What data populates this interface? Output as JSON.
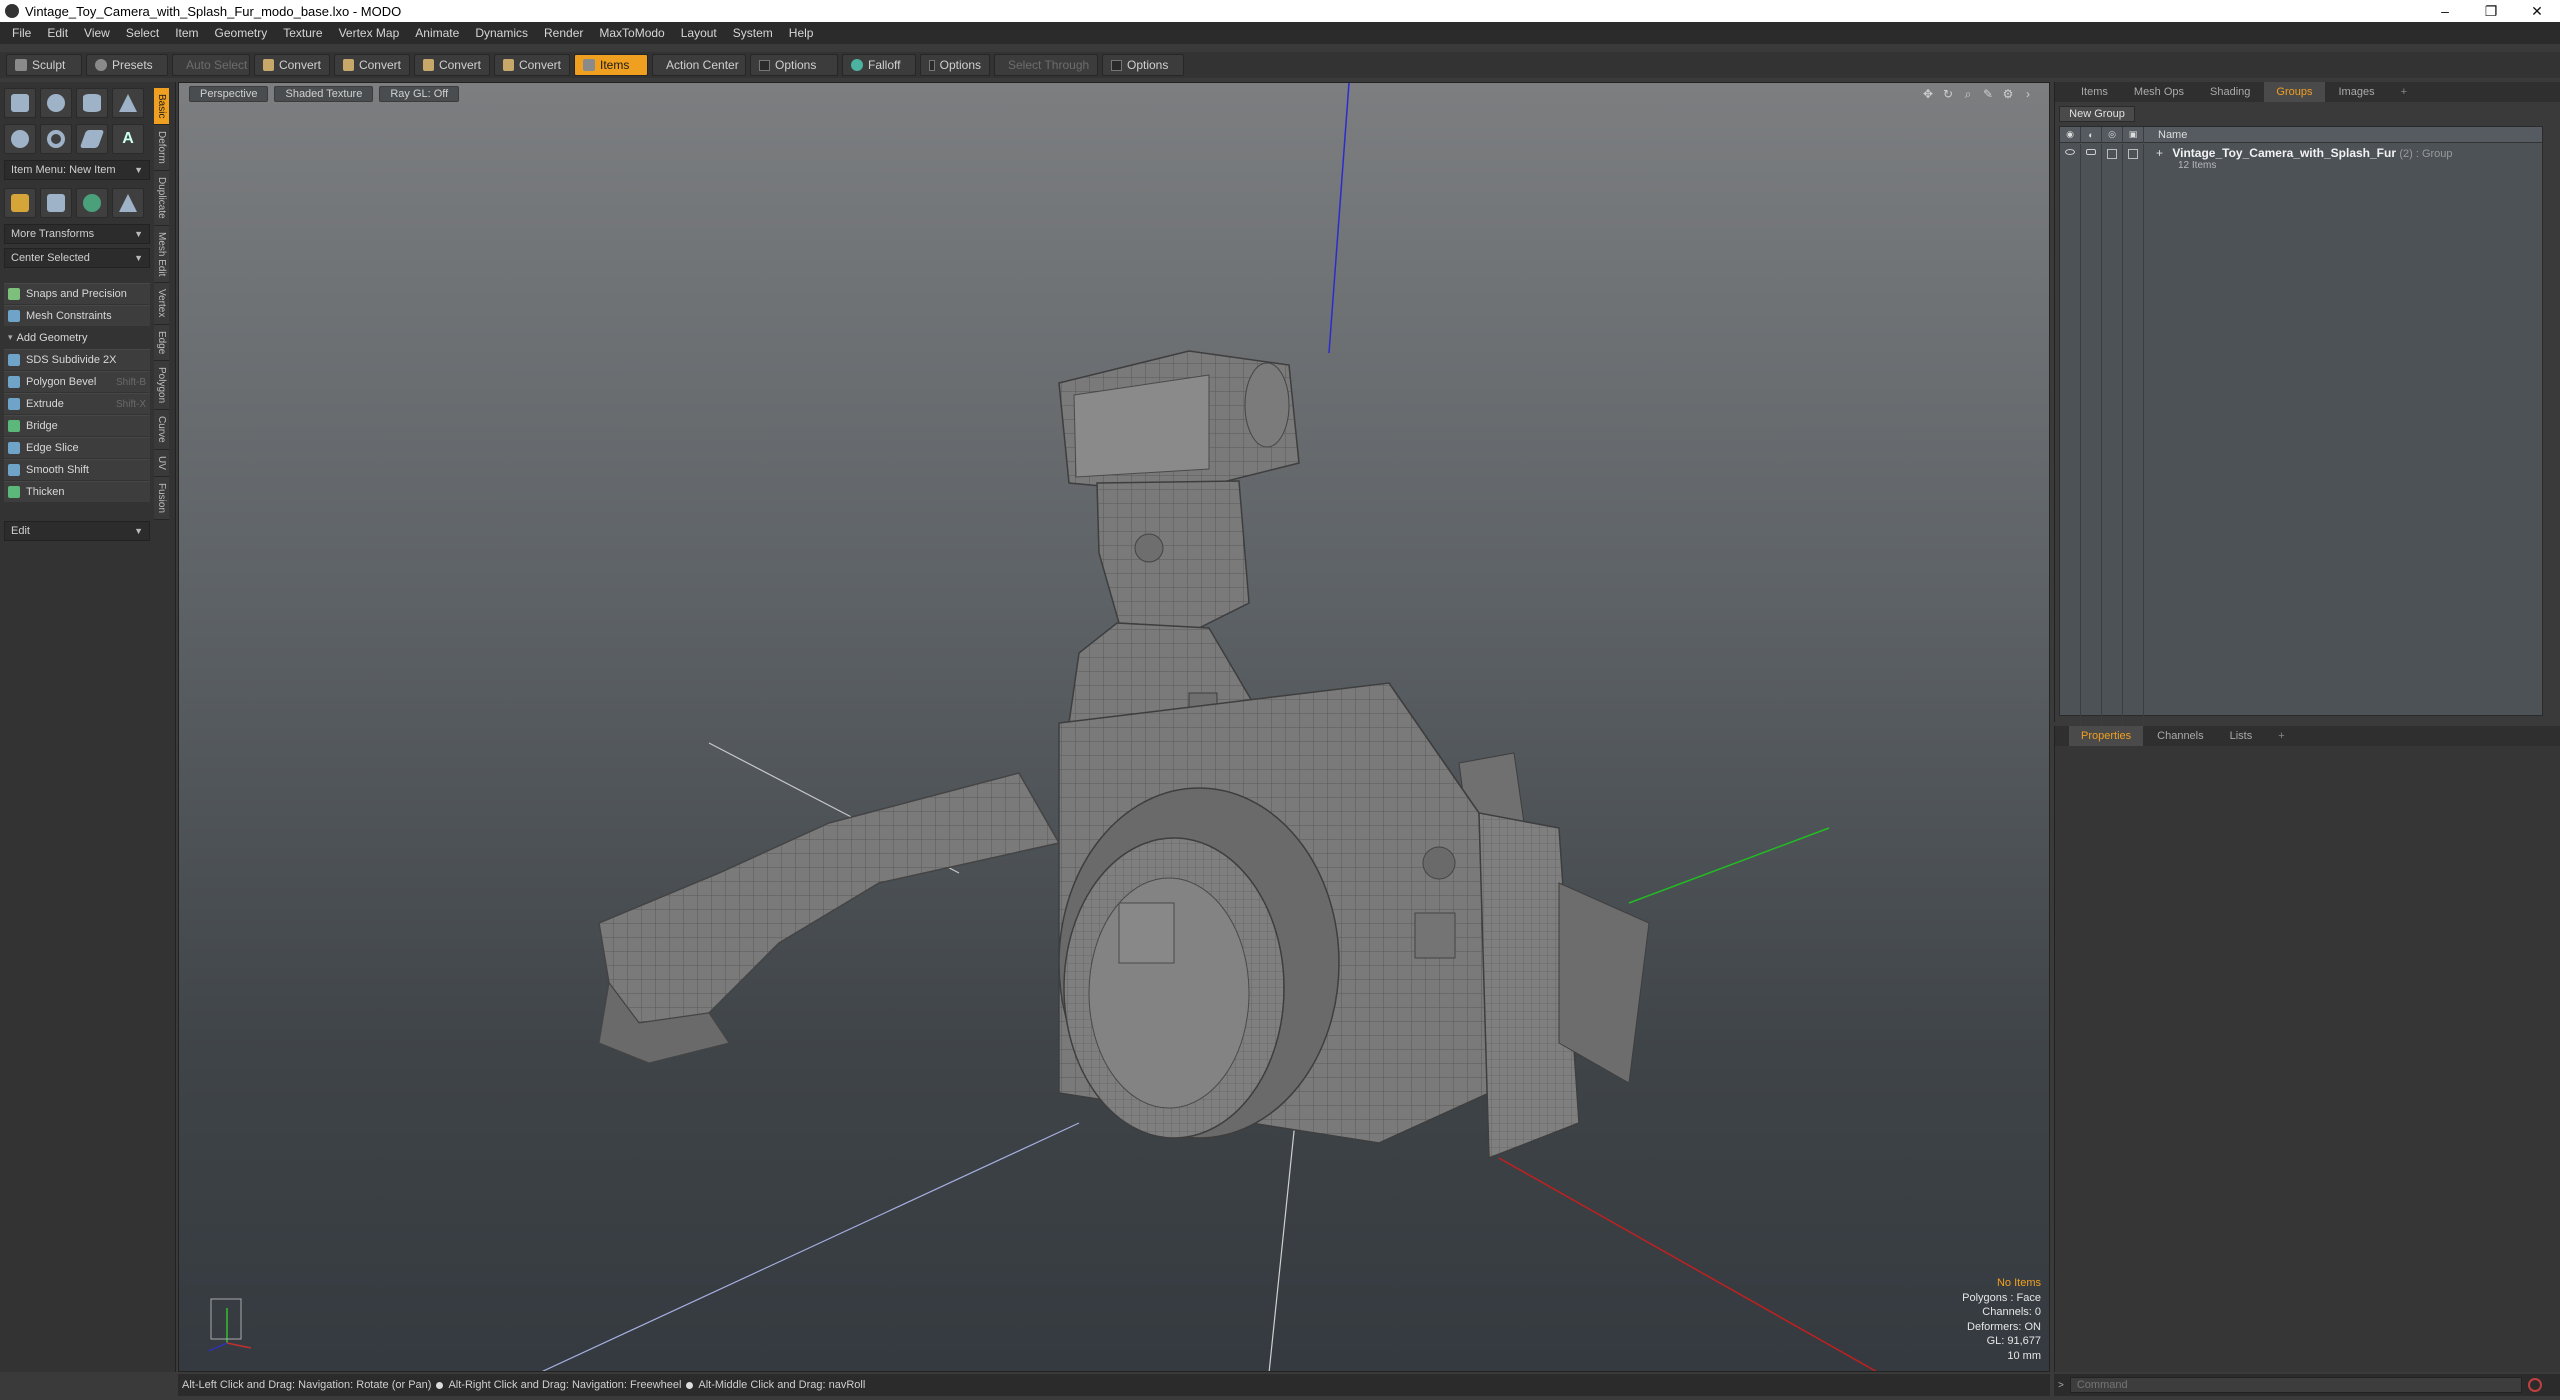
{
  "window": {
    "title": "Vintage_Toy_Camera_with_Splash_Fur_modo_base.lxo - MODO",
    "controls": [
      "–",
      "❐",
      "✕"
    ]
  },
  "menu": [
    "File",
    "Edit",
    "View",
    "Select",
    "Item",
    "Geometry",
    "Texture",
    "Vertex Map",
    "Animate",
    "Dynamics",
    "Render",
    "MaxToModo",
    "Layout",
    "System",
    "Help"
  ],
  "toolbar": {
    "sculpt": "Sculpt",
    "presets": "Presets",
    "auto_select": "Auto Select",
    "convert1": "Convert",
    "convert2": "Convert",
    "convert3": "Convert",
    "convert4": "Convert",
    "items": "Items",
    "action_center": "Action Center",
    "options1": "Options",
    "falloff": "Falloff",
    "options2": "Options",
    "select_through": "Select Through",
    "options3": "Options"
  },
  "toolbox": {
    "item_menu": "Item Menu: New Item",
    "more_transforms": "More Transforms",
    "center_selected": "Center Selected",
    "snaps": "Snaps and Precision",
    "mesh_constraints": "Mesh Constraints",
    "add_geometry": "Add Geometry",
    "tools": [
      {
        "label": "SDS Subdivide 2X",
        "shortcut": ""
      },
      {
        "label": "Polygon Bevel",
        "shortcut": "Shift-B"
      },
      {
        "label": "Extrude",
        "shortcut": "Shift-X"
      },
      {
        "label": "Bridge",
        "shortcut": ""
      },
      {
        "label": "Edge Slice",
        "shortcut": ""
      },
      {
        "label": "Smooth Shift",
        "shortcut": ""
      },
      {
        "label": "Thicken",
        "shortcut": ""
      }
    ],
    "edit": "Edit",
    "vtabs": [
      "Basic",
      "Deform",
      "Duplicate",
      "Mesh Edit",
      "Vertex",
      "Edge",
      "Polygon",
      "Curve",
      "UV",
      "Fusion"
    ]
  },
  "viewport": {
    "tabs": [
      "Perspective",
      "Shaded Texture",
      "Ray GL: Off"
    ],
    "stats": {
      "no_items": "No Items",
      "polygons": "Polygons : Face",
      "channels": "Channels: 0",
      "deformers": "Deformers: ON",
      "gl": "GL: 91,677",
      "scale": "10 mm"
    }
  },
  "right_top": {
    "tabs": [
      "Items",
      "Mesh Ops",
      "Shading",
      "Groups",
      "Images",
      "+"
    ],
    "new_group": "New Group",
    "name_header": "Name",
    "group": {
      "name": "Vintage_Toy_Camera_with_Splash_Fur",
      "meta": "(2) : Group",
      "sub": "12 Items"
    }
  },
  "right_bottom": {
    "tabs": [
      "Properties",
      "Channels",
      "Lists",
      "+"
    ]
  },
  "status": {
    "hint1": "Alt-Left Click and Drag: Navigation: Rotate (or Pan)",
    "hint2": "Alt-Right Click and Drag: Navigation: Freewheel",
    "hint3": "Alt-Middle Click and Drag: navRoll"
  },
  "command": {
    "placeholder": "Command"
  }
}
